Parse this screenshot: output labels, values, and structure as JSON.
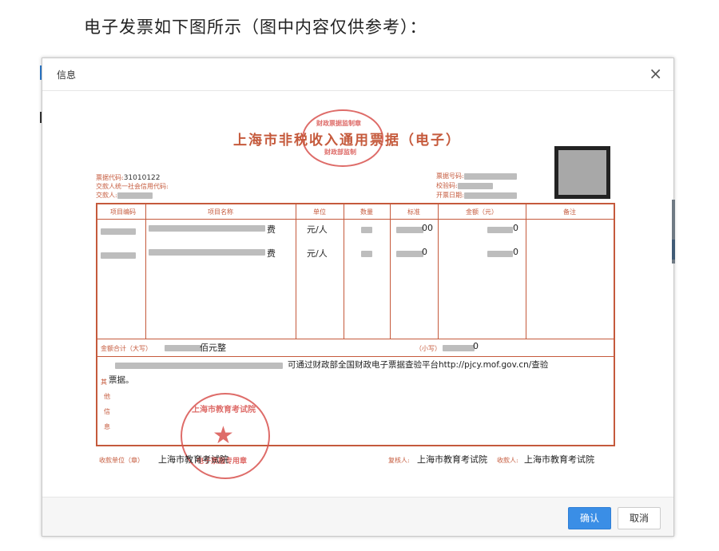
{
  "caption": "电子发票如下图所示（图中内容仅供参考）：",
  "dialog": {
    "title": "信息",
    "close_symbol": "×",
    "ok_label": "确认",
    "cancel_label": "取消",
    "accent_color": "#3a8ee6"
  },
  "invoice": {
    "title": "上海市非税收入通用票据（电子）",
    "code_label": "票据代码:",
    "code_value": "31010122",
    "credit_label": "交款人统一社会信用代码:",
    "payer_label": "交款人:",
    "number_label": "票据号码:",
    "check_label": "校验码:",
    "date_label": "开票日期:",
    "columns": [
      "项目编码",
      "项目名称",
      "单位",
      "数量",
      "标准",
      "金额（元）",
      "备注"
    ],
    "rows": [
      {
        "name_suffix": "费",
        "unit": "元/人",
        "standard_suffix": "00",
        "amount_suffix": "0"
      },
      {
        "name_suffix": "费",
        "unit": "元/人",
        "standard_suffix": "0",
        "amount_suffix": "0"
      }
    ],
    "total_label": "金额合计（大写）",
    "total_suffix": "佰元整",
    "lower_label": "（小写）",
    "lower_suffix": "0",
    "note_text": "可通过财政部全国财政电子票据查验平台http://pjcy.mof.gov.cn/查验",
    "note_text2": "票据。",
    "other_label": [
      "其",
      "他",
      "信",
      "息"
    ],
    "payee_label": "收款单位（章）",
    "payee_value": "上海市教育考试院",
    "reviewer_label": "复核人:",
    "reviewer_value": "上海市教育考试院",
    "collector_label": "收款人:",
    "collector_value": "上海市教育考试院",
    "seal_top_text": "财政票据监制章",
    "seal_top_sub": "财政部监制",
    "seal_bottom_text": "上海市教育考试院",
    "seal_bottom_sub": "电子票据专用章",
    "ink_color": "#c55a3c"
  }
}
